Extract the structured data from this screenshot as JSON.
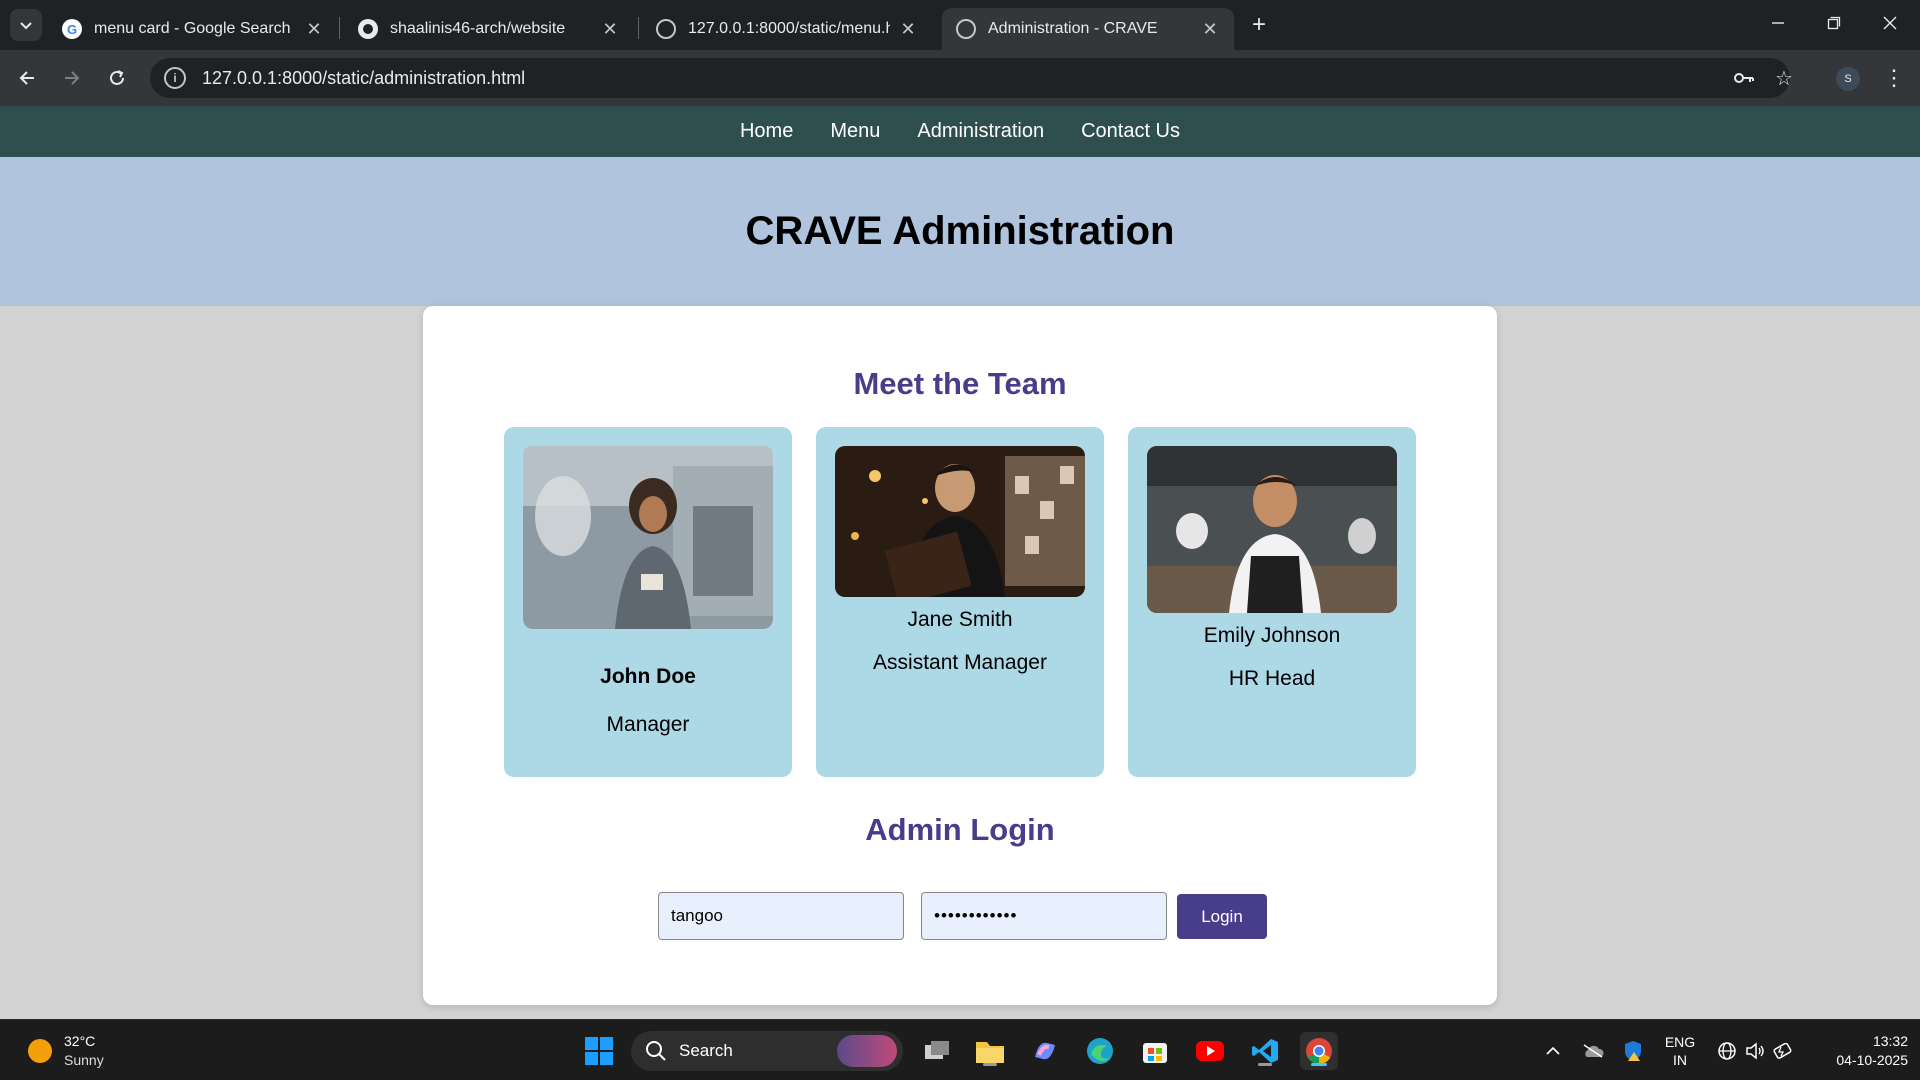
{
  "browser": {
    "tabs": [
      {
        "title": "menu card - Google Search",
        "icon": "google-icon",
        "active": false
      },
      {
        "title": "shaalinis46-arch/website",
        "icon": "github-icon",
        "active": false
      },
      {
        "title": "127.0.0.1:8000/static/menu.htm",
        "icon": "globe-icon",
        "active": false
      },
      {
        "title": "Administration - CRAVE",
        "icon": "globe-icon",
        "active": true
      }
    ],
    "url": "127.0.0.1:8000/static/administration.html",
    "profile_initial": "S"
  },
  "site": {
    "nav": [
      "Home",
      "Menu",
      "Administration",
      "Contact Us"
    ],
    "hero_title": "CRAVE Administration",
    "team_title": "Meet the Team",
    "team": [
      {
        "name": "John Doe",
        "role": "Manager"
      },
      {
        "name": "Jane Smith",
        "role": "Assistant Manager"
      },
      {
        "name": "Emily Johnson",
        "role": "HR Head"
      }
    ],
    "login_title": "Admin Login",
    "username_value": "tangoo",
    "password_value": "••••••••••••",
    "login_button": "Login",
    "colors": {
      "nav_bg": "#2f4f4f",
      "hero_bg": "#b0c4de",
      "card_bg": "#add8e6",
      "accent": "#483d8b"
    }
  },
  "taskbar": {
    "temperature": "32°C",
    "condition": "Sunny",
    "search_label": "Search",
    "lang_top": "ENG",
    "lang_bottom": "IN",
    "time": "13:32",
    "date": "04-10-2025"
  }
}
